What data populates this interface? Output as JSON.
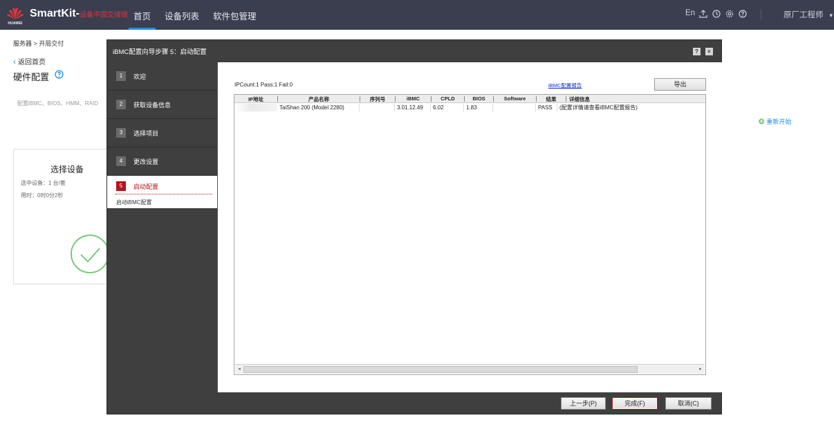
{
  "topbar": {
    "logo_text": "HUAWEI",
    "brand": "SmartKit-",
    "brand_sub": "设备中国交接链",
    "nav": [
      "首页",
      "设备列表",
      "软件包管理"
    ],
    "lang": "En",
    "user": "原厂工程师"
  },
  "page": {
    "breadcrumb": "服务器 > 开局交付",
    "back_label": "返回首页",
    "title": "硬件配置",
    "description": "配置iBMC、BIOS、HMM、RAID",
    "restart_label": "重新开始",
    "card": {
      "title": "选择设备",
      "selected": "选中设备：1 台/套",
      "elapsed": "用时：0时0分2秒"
    }
  },
  "modal": {
    "title": "iBMC配置向导步骤 5：启动配置",
    "help_btn": "?",
    "close_btn": "×",
    "steps": [
      {
        "num": "1",
        "label": "欢迎"
      },
      {
        "num": "2",
        "label": "获取设备信息"
      },
      {
        "num": "3",
        "label": "选择项目"
      },
      {
        "num": "4",
        "label": "更改设置"
      },
      {
        "num": "5",
        "label": "启动配置",
        "sub": "启动iBMC配置"
      }
    ],
    "summary": "IPCount:1 Pass:1 Fail:0",
    "report_link": "iBMC配置报告",
    "export_label": "导出",
    "table": {
      "headers": [
        "IP地址",
        "产品名称",
        "序列号",
        "iBMC",
        "CPLD",
        "BIOS",
        "Software",
        "结果",
        "详细信息"
      ],
      "row": {
        "ip": "",
        "product": "TaiShan 200 (Model 2280)",
        "serial": "",
        "ibmc": "3.01.12.49",
        "cpld": "6.02",
        "bios": "1.83",
        "software": "",
        "result": "PASS",
        "detail": "(配置详情请查看iBMC配置报告)"
      }
    },
    "buttons": {
      "prev": "上一步(P)",
      "finish": "完成(F)",
      "cancel": "取消(C)"
    }
  },
  "colors": {
    "topbar": "#3a3e4f",
    "accent": "#1e8ee6",
    "step_active": "#b3141c",
    "modal_bg": "#3f3f3f"
  }
}
